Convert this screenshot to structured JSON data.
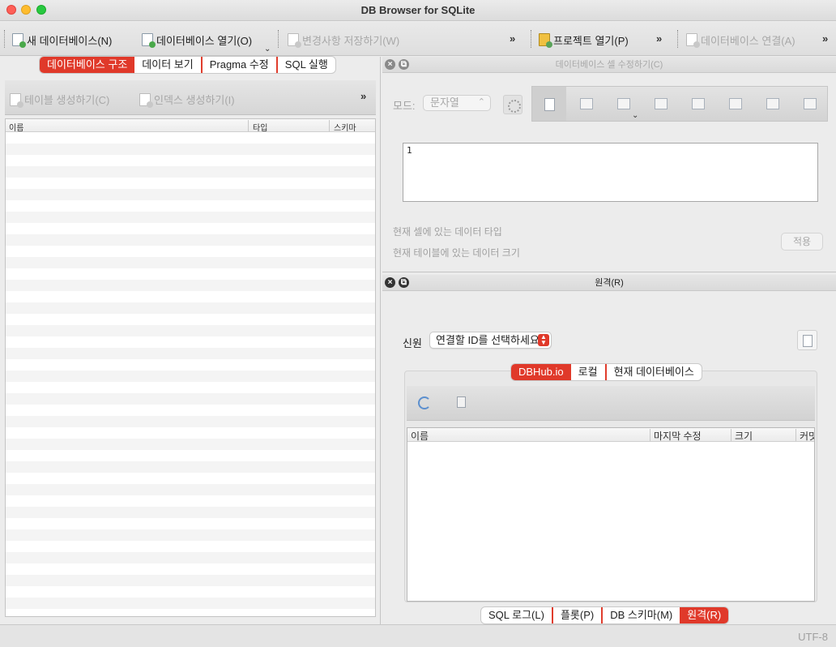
{
  "window": {
    "title": "DB Browser for SQLite"
  },
  "toolbar": {
    "new_db": "새 데이터베이스(N)",
    "open_db": "데이터베이스 열기(O)",
    "write_changes": "변경사항 저장하기(W)",
    "open_project": "프로젝트 열기(P)",
    "attach_db": "데이터베이스 연결(A)",
    "more": "»"
  },
  "left_tabs": {
    "items": [
      "데이터베이스 구조",
      "데이터 보기",
      "Pragma 수정",
      "SQL 실행"
    ],
    "active": "데이터베이스 구조"
  },
  "structure_toolbar": {
    "create_table": "테이블 생성하기(C)",
    "create_index": "인덱스 생성하기(I)",
    "more": "»"
  },
  "schema_tree": {
    "columns": [
      "이름",
      "타입",
      "스키마"
    ]
  },
  "edit_cell": {
    "title": "데이터베이스 셀 수정하기(C)",
    "mode_label": "모드:",
    "mode_value": "문자열",
    "editor_value": "1",
    "type_info": "현재 셀에 있는 데이터 타입",
    "size_info": "현재 테이블에 있는 데이터 크기",
    "apply": "적용"
  },
  "remote": {
    "title": "원격(R)",
    "identity_label": "신원",
    "identity_select": "연결할 ID를 선택하세요",
    "tabs": [
      "DBHub.io",
      "로컬",
      "현재 데이터베이스"
    ],
    "active_tab": "DBHub.io",
    "columns": [
      "이름",
      "마지막 수정",
      "크기",
      "커밋"
    ]
  },
  "bottom_tabs": {
    "items": [
      "SQL 로그(L)",
      "플롯(P)",
      "DB 스키마(M)",
      "원격(R)"
    ],
    "active": "원격(R)"
  },
  "status": {
    "encoding": "UTF-8"
  },
  "colors": {
    "accent": "#e0392a"
  }
}
